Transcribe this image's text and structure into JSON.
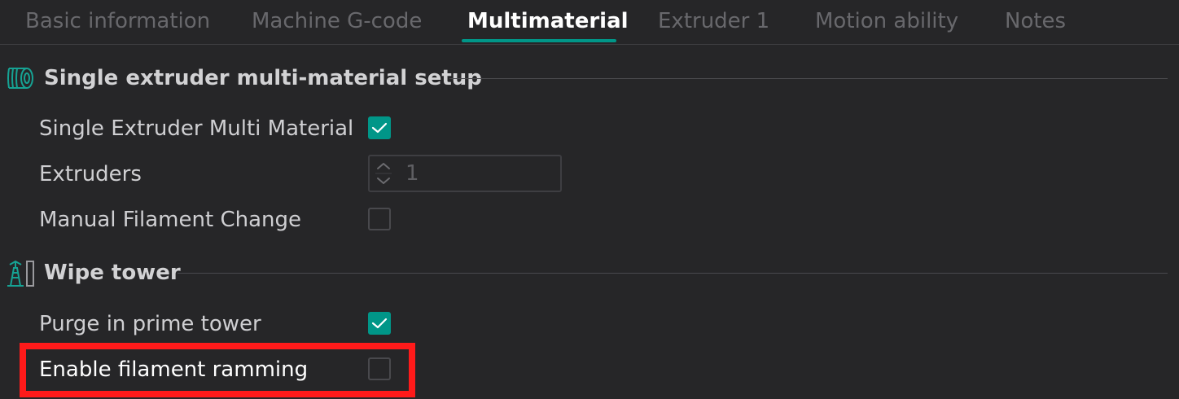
{
  "tabs": [
    {
      "label": "Basic information",
      "active": false
    },
    {
      "label": "Machine G-code",
      "active": false
    },
    {
      "label": "Multimaterial",
      "active": true
    },
    {
      "label": "Extruder 1",
      "active": false
    },
    {
      "label": "Motion ability",
      "active": false
    },
    {
      "label": "Notes",
      "active": false
    }
  ],
  "sections": {
    "multimaterial": {
      "title": "Single extruder multi-material setup",
      "icon": "filament-spool-icon",
      "options": {
        "single_extruder_multi_material": {
          "label": "Single Extruder Multi Material",
          "checked": true
        },
        "extruders": {
          "label": "Extruders",
          "value": "1",
          "disabled": true
        },
        "manual_filament_change": {
          "label": "Manual Filament Change",
          "checked": false
        }
      }
    },
    "wipe_tower": {
      "title": "Wipe tower",
      "icon": "wipe-tower-icon",
      "options": {
        "purge_in_prime_tower": {
          "label": "Purge in prime tower",
          "checked": true
        },
        "enable_filament_ramming": {
          "label": "Enable filament ramming",
          "checked": false,
          "highlighted": true
        }
      }
    }
  },
  "colors": {
    "accent": "#009688",
    "background": "#262628",
    "highlight": "#ff1a1a"
  }
}
